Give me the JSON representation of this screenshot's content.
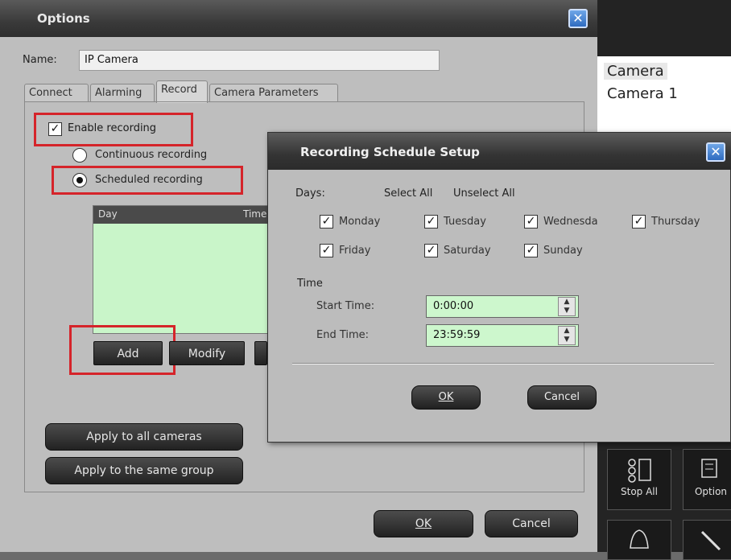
{
  "options": {
    "title": "Options",
    "close_glyph": "✕",
    "name_label": "Name:",
    "name_value": "IP Camera",
    "tabs": [
      {
        "label": "Connect"
      },
      {
        "label": "Alarming"
      },
      {
        "label": "Record"
      },
      {
        "label": "Camera Parameters"
      }
    ],
    "enable_recording": "Enable recording",
    "continuous_recording": "Continuous recording",
    "scheduled_recording": "Scheduled recording",
    "schedule_table": {
      "col_day": "Day",
      "col_time": "Time"
    },
    "add": "Add",
    "modify": "Modify",
    "apply_all": "Apply to all cameras",
    "apply_group": "Apply to the same group",
    "ok": "OK",
    "cancel": "Cancel"
  },
  "right_panel": {
    "cameras": [
      "Camera",
      "Camera 1"
    ],
    "stop_all": "Stop All",
    "options": "Option"
  },
  "dialog": {
    "title": "Recording Schedule Setup",
    "days_label": "Days:",
    "select_all": "Select All",
    "unselect_all": "Unselect All",
    "days": [
      "Monday",
      "Tuesday",
      "Wednesda",
      "Thursday",
      "Friday",
      "Saturday",
      "Sunday"
    ],
    "time_label": "Time",
    "start_label": "Start Time:",
    "start_value": "0:00:00",
    "end_label": "End Time:",
    "end_value": "23:59:59",
    "ok": "OK",
    "cancel": "Cancel"
  },
  "colors": {
    "highlight": "#d5242a",
    "list_bg": "#c9f5c9",
    "accent_blue": "#3a7bd5"
  }
}
